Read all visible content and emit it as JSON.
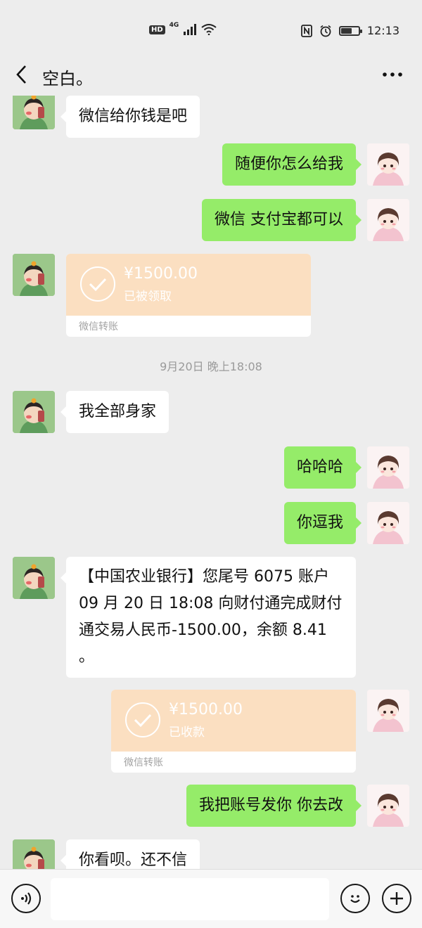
{
  "status_bar": {
    "hd": "HD",
    "network": "4G",
    "time": "12:13"
  },
  "header": {
    "title": "空白。"
  },
  "messages": [
    {
      "side": "in",
      "type": "text",
      "text": "微信给你钱是吧"
    },
    {
      "side": "out",
      "type": "text",
      "text": "随便你怎么给我"
    },
    {
      "side": "out",
      "type": "text",
      "text": "微信 支付宝都可以"
    },
    {
      "side": "in",
      "type": "transfer",
      "amount": "¥1500.00",
      "status": "已被领取",
      "footer": "微信转账"
    },
    {
      "type": "time",
      "text": "9月20日 晚上18:08"
    },
    {
      "side": "in",
      "type": "text",
      "text": "我全部身家"
    },
    {
      "side": "out",
      "type": "text",
      "text": "哈哈哈"
    },
    {
      "side": "out",
      "type": "text",
      "text": "你逗我"
    },
    {
      "side": "in",
      "type": "text",
      "text": "【中国农业银行】您尾号 6075 账户 09 月 20 日 18:08 向财付通完成财付通交易人民币-1500.00，余额 8.41 。"
    },
    {
      "side": "out",
      "type": "transfer",
      "amount": "¥1500.00",
      "status": "已收款",
      "footer": "微信转账"
    },
    {
      "side": "out",
      "type": "text",
      "text": "我把账号发你  你去改"
    },
    {
      "side": "in",
      "type": "text",
      "text": "你看呗。还不信"
    }
  ],
  "colors": {
    "outgoing_bubble": "#95ec69",
    "incoming_bubble": "#ffffff",
    "transfer_card": "#fbdfc1",
    "background": "#ededed"
  },
  "icons": {
    "back": "chevron-left-icon",
    "more": "more-dots-icon",
    "voice": "voice-icon",
    "emoji": "emoji-icon",
    "plus": "plus-icon",
    "transfer": "check-circle-icon"
  }
}
